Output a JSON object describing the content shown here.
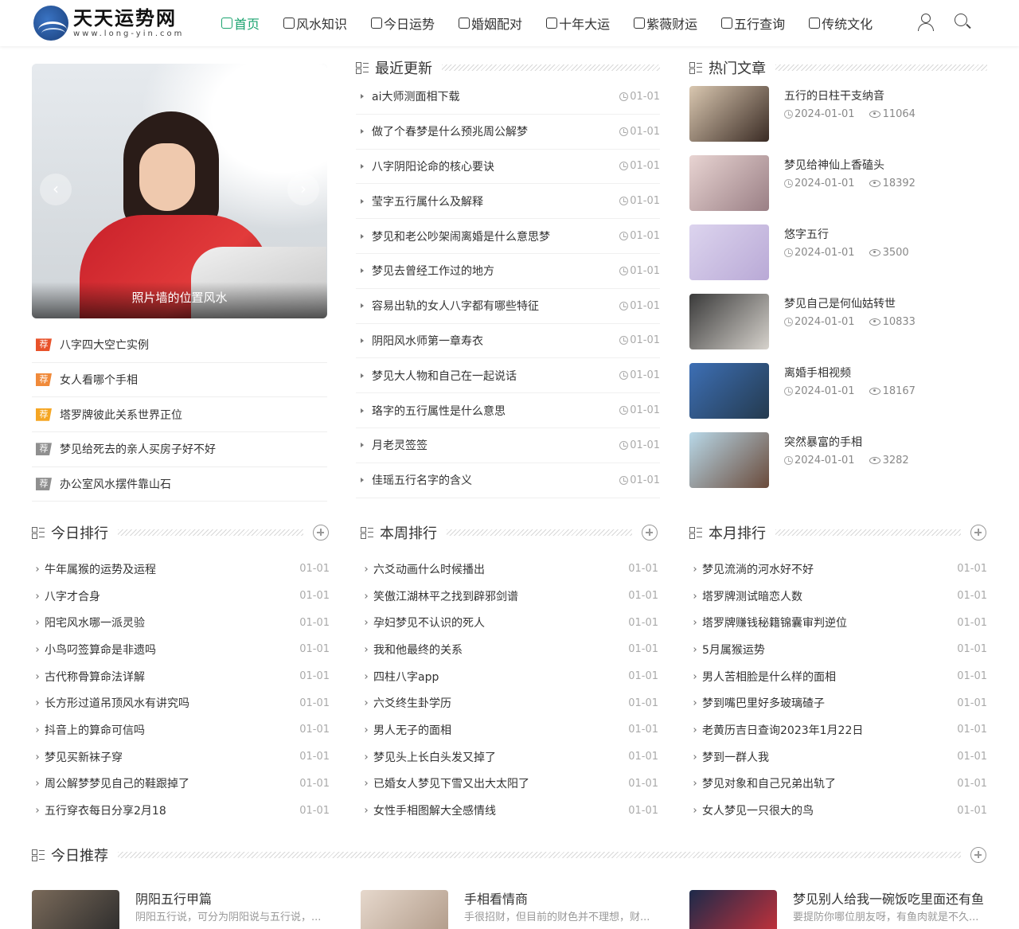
{
  "site": {
    "name": "天天运势网",
    "domain": "www.long-yin.com"
  },
  "nav": [
    {
      "label": "首页",
      "icon": "home-icon",
      "active": true
    },
    {
      "label": "风水知识",
      "icon": "compass-icon"
    },
    {
      "label": "今日运势",
      "icon": "calendar-icon"
    },
    {
      "label": "婚姻配对",
      "icon": "rings-icon"
    },
    {
      "label": "十年大运",
      "icon": "chart-icon"
    },
    {
      "label": "紫薇财运",
      "icon": "document-icon"
    },
    {
      "label": "五行查询",
      "icon": "cloud-icon"
    },
    {
      "label": "传统文化",
      "icon": "lantern-icon"
    }
  ],
  "slider": {
    "caption": "照片墙的位置风水",
    "prev": "‹",
    "next": "›"
  },
  "recommend": {
    "tag": "荐",
    "items": [
      {
        "title": "八字四大空亡实例",
        "color": "#e8522a"
      },
      {
        "title": "女人看哪个手相",
        "color": "#f08a3a"
      },
      {
        "title": "塔罗牌彼此关系世界正位",
        "color": "#f5a623"
      },
      {
        "title": "梦见给死去的亲人买房子好不好",
        "color": "#8f8f8f"
      },
      {
        "title": "办公室风水摆件靠山石",
        "color": "#8f8f8f"
      }
    ]
  },
  "recent": {
    "title": "最近更新",
    "items": [
      {
        "title": "ai大师测面相下载",
        "date": "01-01"
      },
      {
        "title": "做了个春梦是什么预兆周公解梦",
        "date": "01-01"
      },
      {
        "title": "八字阴阳论命的核心要诀",
        "date": "01-01"
      },
      {
        "title": "莹字五行属什么及解释",
        "date": "01-01"
      },
      {
        "title": "梦见和老公吵架闹离婚是什么意思梦",
        "date": "01-01"
      },
      {
        "title": "梦见去曾经工作过的地方",
        "date": "01-01"
      },
      {
        "title": "容易出轨的女人八字都有哪些特征",
        "date": "01-01"
      },
      {
        "title": "阴阳风水师第一章寿衣",
        "date": "01-01"
      },
      {
        "title": "梦见大人物和自己在一起说话",
        "date": "01-01"
      },
      {
        "title": "珞字的五行属性是什么意思",
        "date": "01-01"
      },
      {
        "title": "月老灵签签",
        "date": "01-01"
      },
      {
        "title": "佳瑶五行名字的含义",
        "date": "01-01"
      }
    ]
  },
  "hot": {
    "title": "热门文章",
    "items": [
      {
        "title": "五行的日柱干支纳音",
        "date": "2024-01-01",
        "views": "11064",
        "c1": "#d9c7b0",
        "c2": "#3a2b24"
      },
      {
        "title": "梦见给神仙上香磕头",
        "date": "2024-01-01",
        "views": "18392",
        "c1": "#e8d4d2",
        "c2": "#9a7f85"
      },
      {
        "title": "悠字五行",
        "date": "2024-01-01",
        "views": "3500",
        "c1": "#dcd4ee",
        "c2": "#b9a9d6"
      },
      {
        "title": "梦见自己是何仙姑转世",
        "date": "2024-01-01",
        "views": "10833",
        "c1": "#3a3a3a",
        "c2": "#d6d2cc"
      },
      {
        "title": "离婚手相视频",
        "date": "2024-01-01",
        "views": "18167",
        "c1": "#3d6fb5",
        "c2": "#243a4e"
      },
      {
        "title": "突然暴富的手相",
        "date": "2024-01-01",
        "views": "3282",
        "c1": "#b8d8e8",
        "c2": "#6a4a3a"
      }
    ]
  },
  "rank_today": {
    "title": "今日排行",
    "items": [
      {
        "title": "牛年属猴的运势及运程",
        "date": "01-01"
      },
      {
        "title": "八字才合身",
        "date": "01-01"
      },
      {
        "title": "阳宅风水哪一派灵验",
        "date": "01-01"
      },
      {
        "title": "小鸟叼签算命是非遗吗",
        "date": "01-01"
      },
      {
        "title": "古代称骨算命法详解",
        "date": "01-01"
      },
      {
        "title": "长方形过道吊顶风水有讲究吗",
        "date": "01-01"
      },
      {
        "title": "抖音上的算命可信吗",
        "date": "01-01"
      },
      {
        "title": "梦见买新袜子穿",
        "date": "01-01"
      },
      {
        "title": "周公解梦梦见自己的鞋跟掉了",
        "date": "01-01"
      },
      {
        "title": "五行穿衣每日分享2月18",
        "date": "01-01"
      }
    ]
  },
  "rank_week": {
    "title": "本周排行",
    "items": [
      {
        "title": "六爻动画什么时候播出",
        "date": "01-01"
      },
      {
        "title": "笑傲江湖林平之找到辟邪剑谱",
        "date": "01-01"
      },
      {
        "title": "孕妇梦见不认识的死人",
        "date": "01-01"
      },
      {
        "title": "我和他最终的关系",
        "date": "01-01"
      },
      {
        "title": "四柱八字app",
        "date": "01-01"
      },
      {
        "title": "六爻终生卦学历",
        "date": "01-01"
      },
      {
        "title": "男人无子的面相",
        "date": "01-01"
      },
      {
        "title": "梦见头上长白头发又掉了",
        "date": "01-01"
      },
      {
        "title": "已婚女人梦见下雪又出大太阳了",
        "date": "01-01"
      },
      {
        "title": "女性手相图解大全感情线",
        "date": "01-01"
      }
    ]
  },
  "rank_month": {
    "title": "本月排行",
    "items": [
      {
        "title": "梦见流淌的河水好不好",
        "date": "01-01"
      },
      {
        "title": "塔罗牌测试暗恋人数",
        "date": "01-01"
      },
      {
        "title": "塔罗牌赚钱秘籍锦囊审判逆位",
        "date": "01-01"
      },
      {
        "title": "5月属猴运势",
        "date": "01-01"
      },
      {
        "title": "男人苦相脸是什么样的面相",
        "date": "01-01"
      },
      {
        "title": "梦到嘴巴里好多玻璃碴子",
        "date": "01-01"
      },
      {
        "title": "老黄历吉日查询2023年1月22日",
        "date": "01-01"
      },
      {
        "title": "梦到一群人我",
        "date": "01-01"
      },
      {
        "title": "梦见对象和自己兄弟出轨了",
        "date": "01-01"
      },
      {
        "title": "女人梦见一只很大的鸟",
        "date": "01-01"
      }
    ]
  },
  "today_rec": {
    "title": "今日推荐",
    "items": [
      {
        "title": "阴阳五行甲篇",
        "desc": "阴阳五行说，可分为阴阳说与五行说，...",
        "c1": "#7a6a5a",
        "c2": "#2b2b2b"
      },
      {
        "title": "手相看情商",
        "desc": "手很招财，但目前的财色并不理想，财...",
        "c1": "#e6d8cc",
        "c2": "#b09a88"
      },
      {
        "title": "梦见别人给我一碗饭吃里面还有鱼",
        "desc": "要提防你哪位朋友呀，有鱼肉就是不久...",
        "c1": "#1d2a4a",
        "c2": "#c8313a"
      }
    ]
  }
}
